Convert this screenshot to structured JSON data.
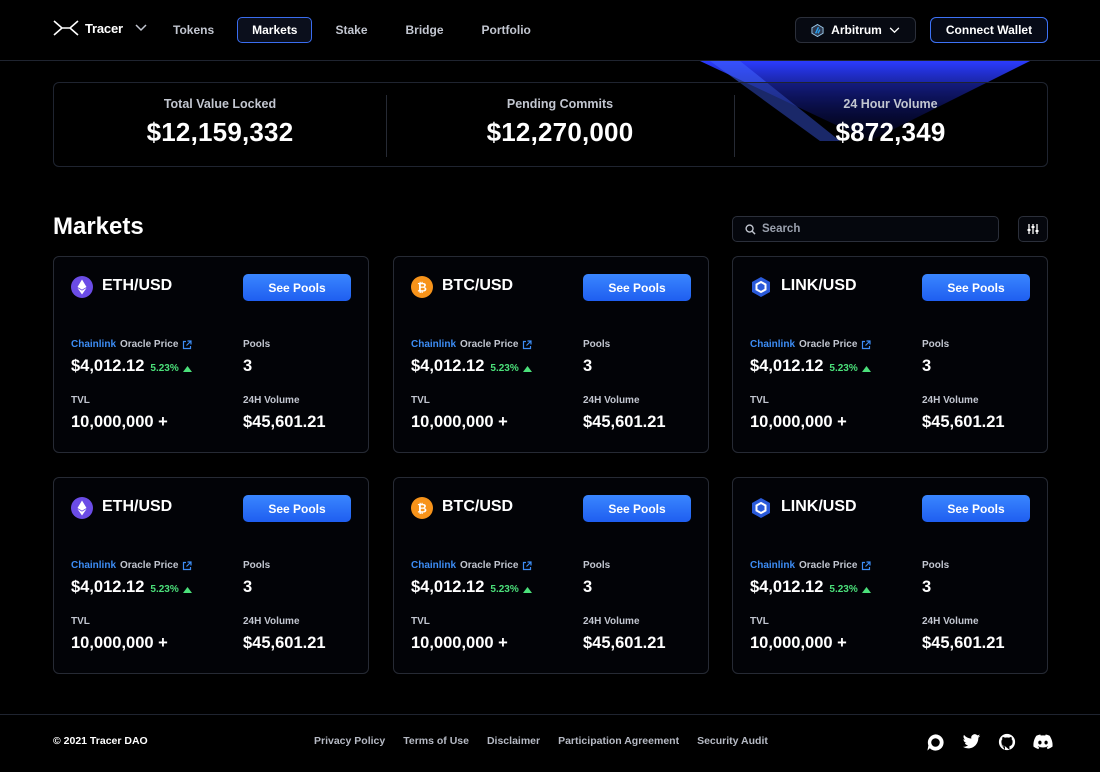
{
  "nav": {
    "brand": "Tracer",
    "links": [
      {
        "label": "Tokens",
        "active": false
      },
      {
        "label": "Markets",
        "active": true
      },
      {
        "label": "Stake",
        "active": false
      },
      {
        "label": "Bridge",
        "active": false
      },
      {
        "label": "Portfolio",
        "active": false
      }
    ],
    "network": "Arbitrum",
    "connect": "Connect Wallet"
  },
  "stats": [
    {
      "label": "Total Value Locked",
      "value": "$12,159,332"
    },
    {
      "label": "Pending Commits",
      "value": "$12,270,000"
    },
    {
      "label": "24 Hour Volume",
      "value": "$872,349"
    }
  ],
  "markets": {
    "title": "Markets",
    "search_placeholder": "Search",
    "card_labels": {
      "see_pools": "See Pools",
      "oracle_link": "Chainlink",
      "oracle_suffix": "Oracle Price",
      "pools": "Pools",
      "tvl": "TVL",
      "volume": "24H Volume"
    },
    "cards": [
      {
        "pair": "ETH/USD",
        "icon": "eth-icon",
        "price": "$4,012.12",
        "change": "5.23%",
        "pools": "3",
        "tvl": "10,000,000 +",
        "volume": "$45,601.21"
      },
      {
        "pair": "BTC/USD",
        "icon": "btc-icon",
        "price": "$4,012.12",
        "change": "5.23%",
        "pools": "3",
        "tvl": "10,000,000 +",
        "volume": "$45,601.21"
      },
      {
        "pair": "LINK/USD",
        "icon": "link-icon",
        "price": "$4,012.12",
        "change": "5.23%",
        "pools": "3",
        "tvl": "10,000,000 +",
        "volume": "$45,601.21"
      },
      {
        "pair": "ETH/USD",
        "icon": "eth-icon",
        "price": "$4,012.12",
        "change": "5.23%",
        "pools": "3",
        "tvl": "10,000,000 +",
        "volume": "$45,601.21"
      },
      {
        "pair": "BTC/USD",
        "icon": "btc-icon",
        "price": "$4,012.12",
        "change": "5.23%",
        "pools": "3",
        "tvl": "10,000,000 +",
        "volume": "$45,601.21"
      },
      {
        "pair": "LINK/USD",
        "icon": "link-icon",
        "price": "$4,012.12",
        "change": "5.23%",
        "pools": "3",
        "tvl": "10,000,000 +",
        "volume": "$45,601.21"
      }
    ]
  },
  "footer": {
    "copyright": "© 2021 Tracer DAO",
    "links": [
      "Privacy Policy",
      "Terms of Use",
      "Disclaimer",
      "Participation Agreement",
      "Security Audit"
    ],
    "socials": [
      "discourse-icon",
      "twitter-icon",
      "github-icon",
      "discord-icon"
    ]
  },
  "colors": {
    "accent": "#3a86ff",
    "positive": "#4be07a",
    "eth": "#6b4ce6",
    "btc": "#f7931a",
    "link": "#2a5ada"
  }
}
